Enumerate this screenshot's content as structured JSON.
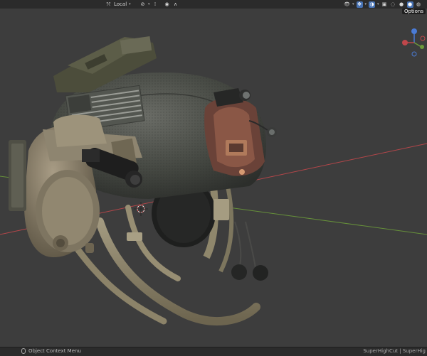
{
  "header": {
    "transform_orientation": "Local",
    "icons": [
      "transform-orientation-icon",
      "snap-icon",
      "proportional-edit-icon",
      "viewport-display-icon",
      "overlays-icon",
      "xray-icon",
      "shading-mode-icons"
    ]
  },
  "gizmo": {
    "tooltip": "Options",
    "axes": [
      "X",
      "Y",
      "Z"
    ]
  },
  "status": {
    "left_label": "Object Context Menu",
    "right_label": "SuperHighCut | SuperHig"
  },
  "colors": {
    "viewport_bg": "#3d3d3d",
    "x_axis": "#c0474b",
    "y_axis": "#6b9a3a",
    "header_bg": "#2b2b2b",
    "accent": "#4772b3"
  }
}
